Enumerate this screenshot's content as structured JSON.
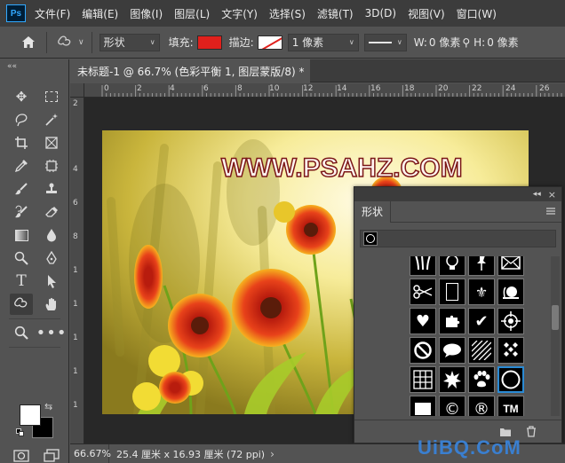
{
  "app": {
    "logo": "Ps"
  },
  "menu": [
    "文件(F)",
    "编辑(E)",
    "图像(I)",
    "图层(L)",
    "文字(Y)",
    "选择(S)",
    "滤镜(T)",
    "3D(D)",
    "视图(V)",
    "窗口(W)"
  ],
  "options": {
    "mode": "形状",
    "fill_label": "填充:",
    "stroke_label": "描边:",
    "stroke_width": "1 像素",
    "w_label": "W:",
    "w_value": "0 像素",
    "h_label": "H:",
    "h_value": "0 像素",
    "fill_color": "#e0201c"
  },
  "document": {
    "tab_title": "未标题-1 @ 66.7% (色彩平衡 1, 图层蒙版/8) *",
    "close": "×",
    "artwork_text": "WWW.PSAHZ.COM"
  },
  "ruler": {
    "h_ticks": [
      "0",
      "2",
      "4",
      "6",
      "8",
      "10",
      "12",
      "14",
      "16",
      "18",
      "20",
      "22",
      "24",
      "26"
    ],
    "v_ticks": [
      "2",
      "4",
      "6",
      "8",
      "1",
      "1",
      "1",
      "1",
      "1"
    ]
  },
  "panel": {
    "collapse": "◂◂",
    "close": "×",
    "title": "形状"
  },
  "status": {
    "zoom": "66.67%",
    "info": "25.4 厘米 x 16.93 厘米 (72 ppi)",
    "arrow": "›"
  },
  "watermark": "UiBQ.CoM"
}
